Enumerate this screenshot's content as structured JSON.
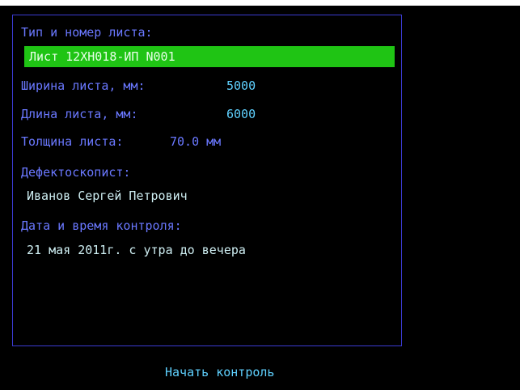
{
  "panel": {
    "sheet_label": "Тип и номер листа:",
    "sheet_value": "Лист 12ХН018-ИП N001",
    "width_label": "Ширина листа, мм:",
    "width_value": "5000",
    "length_label": "Длина листа, мм:",
    "length_value": "6000",
    "thickness_label": "Толщина листа:",
    "thickness_value": "70.0 мм",
    "inspector_label": "Дефектоскопист:",
    "inspector_value": "Иванов Сергей Петрович",
    "datetime_label": "Дата и время контроля:",
    "datetime_value": "21 мая 2011г. с утра до вечера"
  },
  "actions": {
    "start_label": "Начать контроль"
  },
  "colors": {
    "background": "#000000",
    "border": "#3b3bd2",
    "label": "#6a78ff",
    "value": "#cfeff3",
    "accent": "#5fd1ff",
    "highlight": "#1fc414"
  }
}
